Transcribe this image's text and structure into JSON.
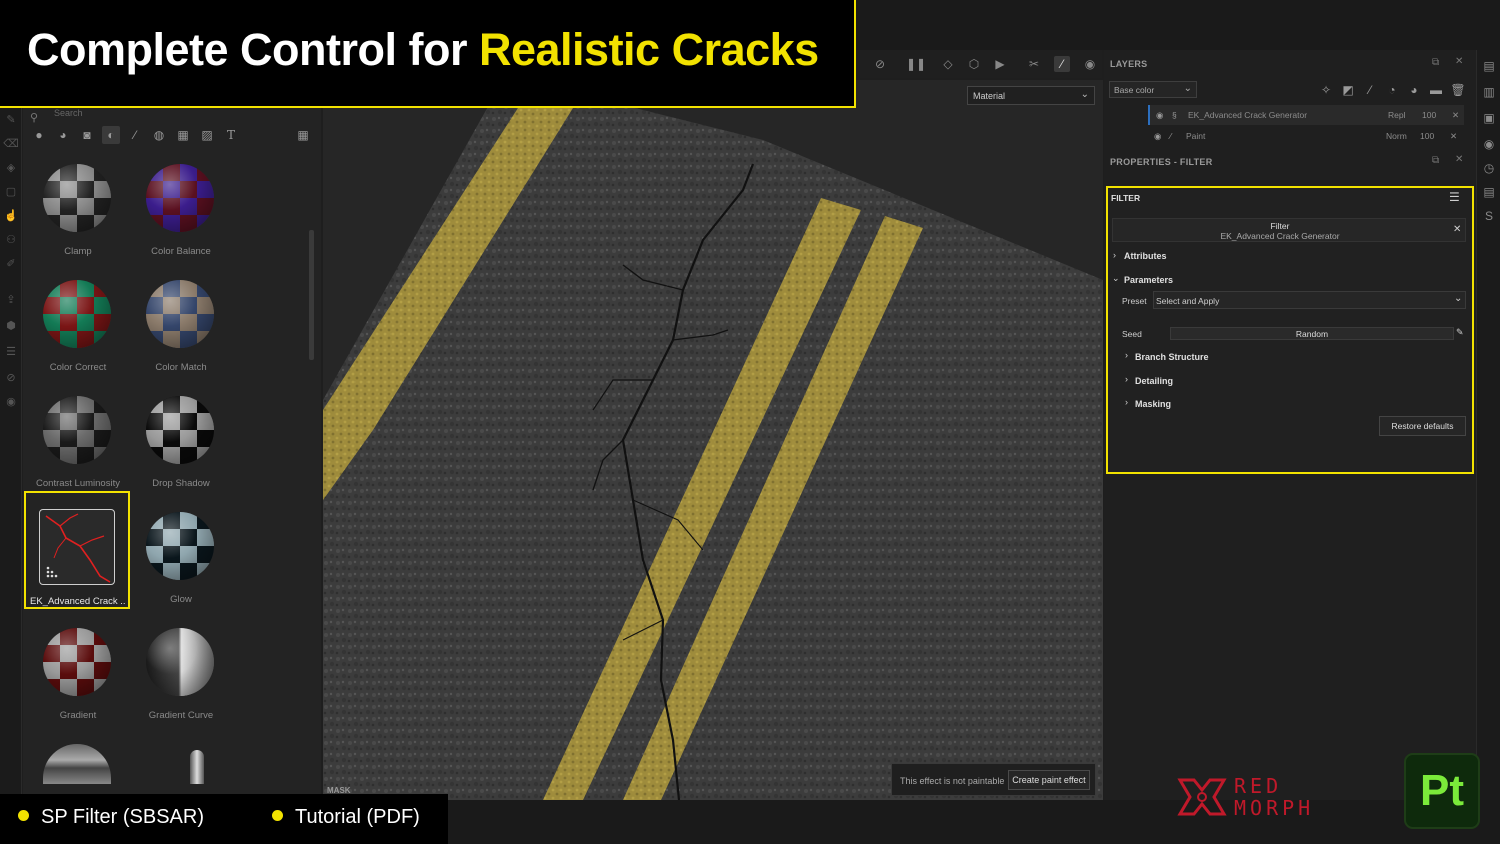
{
  "banner": {
    "title_prefix": "Complete Control for ",
    "title_highlight": "Realistic Cracks",
    "accent_color": "#f2e200"
  },
  "shelf": {
    "search_placeholder": "Search",
    "tabs": [
      "materials",
      "smart-materials",
      "smart-masks",
      "filters",
      "brushes",
      "alphas",
      "grunges",
      "environments",
      "text"
    ],
    "active_tab": "filters",
    "items": [
      {
        "label": "Clamp",
        "colors": [
          "#2a2a2a",
          "#8a8a8a"
        ]
      },
      {
        "label": "Color Balance",
        "colors": [
          "#5a1020",
          "#3a1a8a"
        ]
      },
      {
        "label": "Color Correct",
        "colors": [
          "#7a1515",
          "#137a55"
        ]
      },
      {
        "label": "Color Match",
        "colors": [
          "#3a4a6a",
          "#8a7a6a"
        ]
      },
      {
        "label": "Contrast Luminosity",
        "colors": [
          "#1a1a1a",
          "#6a6a6a"
        ]
      },
      {
        "label": "Drop Shadow",
        "colors": [
          "#0a0a0a",
          "#9a9a9a"
        ]
      },
      {
        "label": "EK_Advanced Crack ...",
        "colors": [
          "#2a2a2a",
          "#2a2a2a"
        ]
      },
      {
        "label": "Glow",
        "colors": [
          "#0a1a20",
          "#9a9a9a"
        ]
      },
      {
        "label": "Gradient",
        "colors": [
          "#5a0c0c",
          "#aaaaaa"
        ]
      },
      {
        "label": "Gradient Curve",
        "colors": [
          "#222222",
          "#bbbbbb"
        ]
      }
    ]
  },
  "viewport": {
    "material_mode": "Material",
    "paint_note": "This effect is not paintable",
    "create_paint_effect": "Create paint effect",
    "mask_label": "MASK"
  },
  "layers": {
    "title": "LAYERS",
    "channel": "Base color",
    "rows": [
      {
        "name": "EK_Advanced Crack Generator",
        "blend": "Repl",
        "opacity": "100"
      },
      {
        "name": "Paint",
        "blend": "Norm",
        "opacity": "100"
      }
    ]
  },
  "properties": {
    "title": "PROPERTIES - FILTER",
    "section": "FILTER",
    "filter_label": "Filter",
    "filter_name": "EK_Advanced Crack Generator",
    "attributes": "Attributes",
    "parameters": "Parameters",
    "preset_label": "Preset",
    "preset_value": "Select and Apply",
    "seed_label": "Seed",
    "seed_value": "Random",
    "groups": [
      "Branch Structure",
      "Detailing",
      "Masking"
    ],
    "restore": "Restore defaults"
  },
  "footer": {
    "item1": "SP Filter (SBSAR)",
    "item2": "Tutorial (PDF)",
    "brand_line1": "RED",
    "brand_line2": "MORPH",
    "app_logo": "Pt",
    "brand_color": "#c0192a"
  }
}
